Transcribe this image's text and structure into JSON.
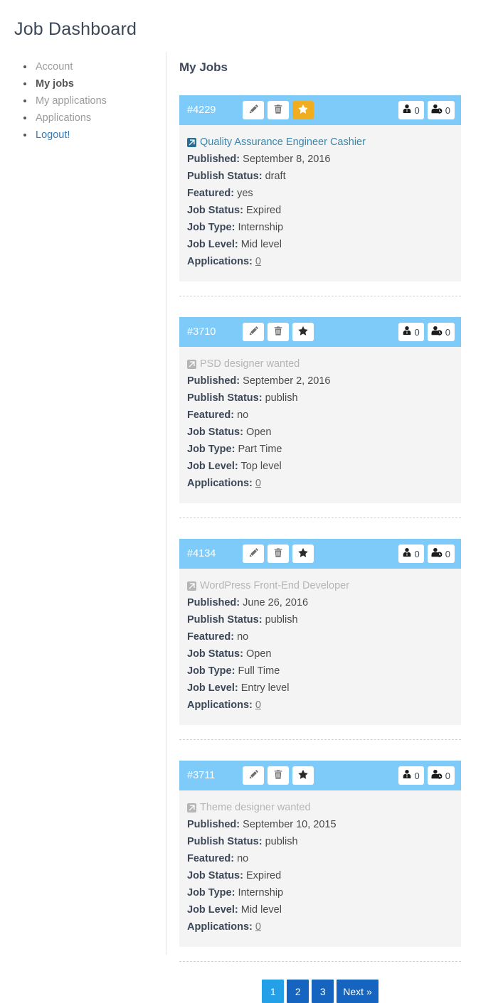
{
  "page": {
    "title": "Job Dashboard",
    "main_heading": "My Jobs"
  },
  "sidebar": {
    "items": [
      {
        "label": "Account",
        "state": "normal"
      },
      {
        "label": "My jobs",
        "state": "active"
      },
      {
        "label": "My applications",
        "state": "normal"
      },
      {
        "label": "Applications",
        "state": "normal"
      },
      {
        "label": "Logout!",
        "state": "logout"
      }
    ]
  },
  "labels": {
    "published": "Published:",
    "publish_status": "Publish Status:",
    "featured": "Featured:",
    "job_status": "Job Status:",
    "job_type": "Job Type:",
    "job_level": "Job Level:",
    "applications": "Applications:"
  },
  "icons": {
    "edit": "pencil-icon",
    "delete": "trash-icon",
    "feature": "star-icon",
    "candidates": "user-tie-icon",
    "pending": "user-clock-icon",
    "external": "external-link-icon"
  },
  "colors": {
    "card_header": "#7ecbfa",
    "card_body": "#f4f4f4",
    "featured_accent": "#f0ad20",
    "pagination": "#1565c0",
    "pagination_active": "#24a0e8",
    "link": "#3a87ad"
  },
  "jobs": [
    {
      "id": "#4229",
      "title": "Quality Assurance Engineer Cashier",
      "title_is_link": true,
      "featured_highlight": true,
      "candidates_count": "0",
      "pending_count": "0",
      "published": "September 8, 2016",
      "publish_status": "draft",
      "featured": "yes",
      "job_status": "Expired",
      "job_type": "Internship",
      "job_level": "Mid level",
      "applications": "0"
    },
    {
      "id": "#3710",
      "title": "PSD designer wanted",
      "title_is_link": false,
      "featured_highlight": false,
      "candidates_count": "0",
      "pending_count": "0",
      "published": "September 2, 2016",
      "publish_status": "publish",
      "featured": "no",
      "job_status": "Open",
      "job_type": "Part Time",
      "job_level": "Top level",
      "applications": "0"
    },
    {
      "id": "#4134",
      "title": "WordPress Front-End Developer",
      "title_is_link": false,
      "featured_highlight": false,
      "candidates_count": "0",
      "pending_count": "0",
      "published": "June 26, 2016",
      "publish_status": "publish",
      "featured": "no",
      "job_status": "Open",
      "job_type": "Full Time",
      "job_level": "Entry level",
      "applications": "0"
    },
    {
      "id": "#3711",
      "title": "Theme designer wanted",
      "title_is_link": false,
      "featured_highlight": false,
      "candidates_count": "0",
      "pending_count": "0",
      "published": "September 10, 2015",
      "publish_status": "publish",
      "featured": "no",
      "job_status": "Expired",
      "job_type": "Internship",
      "job_level": "Mid level",
      "applications": "0"
    }
  ],
  "pagination": {
    "pages": [
      {
        "label": "1",
        "active": true
      },
      {
        "label": "2",
        "active": false
      },
      {
        "label": "3",
        "active": false
      }
    ],
    "next_label": "Next »"
  }
}
